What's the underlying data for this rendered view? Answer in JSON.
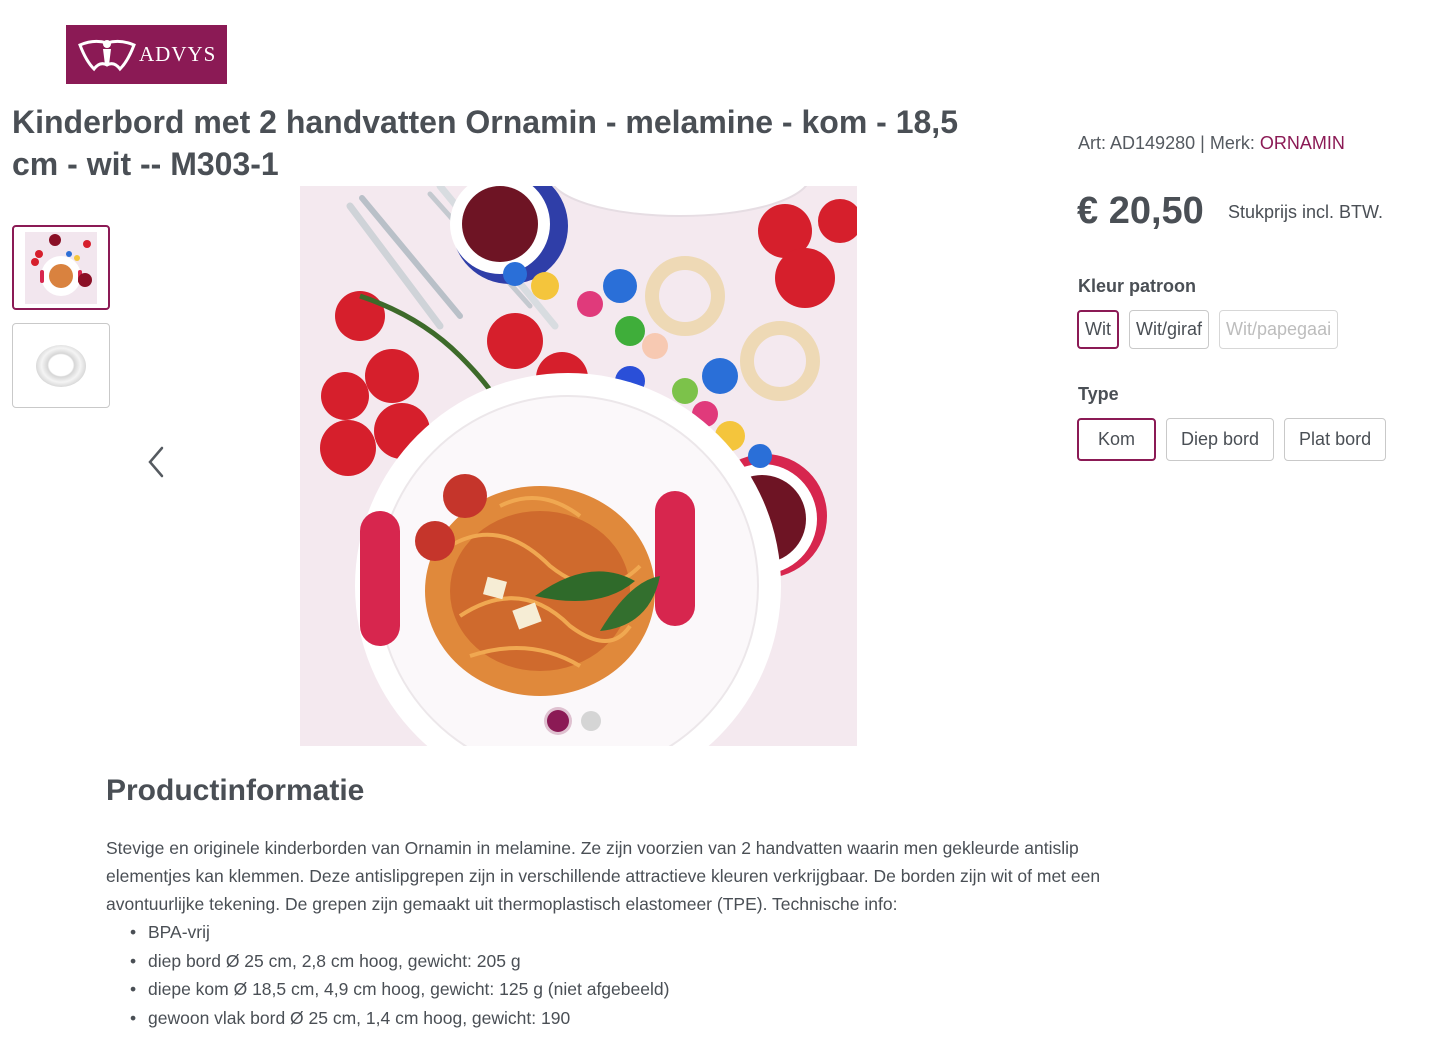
{
  "brand": {
    "logo_text": "ADVYS",
    "logo_color": "#8b1a55"
  },
  "product": {
    "title": "Kinderbord met 2 handvatten Ornamin - melamine - kom - 18,5 cm - wit -- M303-1",
    "art_label": "Art:",
    "art_number": "AD149280",
    "separator": "|",
    "brand_label": "Merk:",
    "brand_name": "ORNAMIN",
    "price": "€ 20,50",
    "price_note": "Stukprijs incl. BTW."
  },
  "gallery": {
    "thumbnails": [
      {
        "icon": "plate-pasta-photo",
        "active": true
      },
      {
        "icon": "white-bowl-photo",
        "active": false
      }
    ],
    "dots": [
      {
        "active": true
      },
      {
        "active": false
      }
    ]
  },
  "options": {
    "color": {
      "label": "Kleur patroon",
      "items": [
        {
          "label": "Wit",
          "selected": true,
          "disabled": false
        },
        {
          "label": "Wit/giraf",
          "selected": false,
          "disabled": false
        },
        {
          "label": "Wit/papegaai",
          "selected": false,
          "disabled": true
        }
      ]
    },
    "type": {
      "label": "Type",
      "items": [
        {
          "label": "Kom",
          "selected": true
        },
        {
          "label": "Diep bord",
          "selected": false
        },
        {
          "label": "Plat bord",
          "selected": false
        }
      ]
    }
  },
  "info": {
    "title": "Productinformatie",
    "text": "Stevige en originele kinderborden van Ornamin in melamine. Ze zijn voorzien van 2 handvatten waarin men gekleurde antislip elementjes kan klemmen. Deze antislipgrepen zijn in verschillende attractieve kleuren verkrijgbaar. De borden zijn wit of met een avontuurlijke tekening. De grepen zijn gemaakt uit thermoplastisch elastomeer (TPE). Technische info:",
    "specs": [
      "BPA-vrij",
      "diep bord Ø 25 cm, 2,8 cm hoog, gewicht: 205 g",
      "diepe kom Ø 18,5 cm, 4,9 cm hoog, gewicht: 125 g (niet afgebeeld)",
      "gewoon vlak bord Ø 25 cm, 1,4 cm hoog, gewicht: 190"
    ]
  }
}
